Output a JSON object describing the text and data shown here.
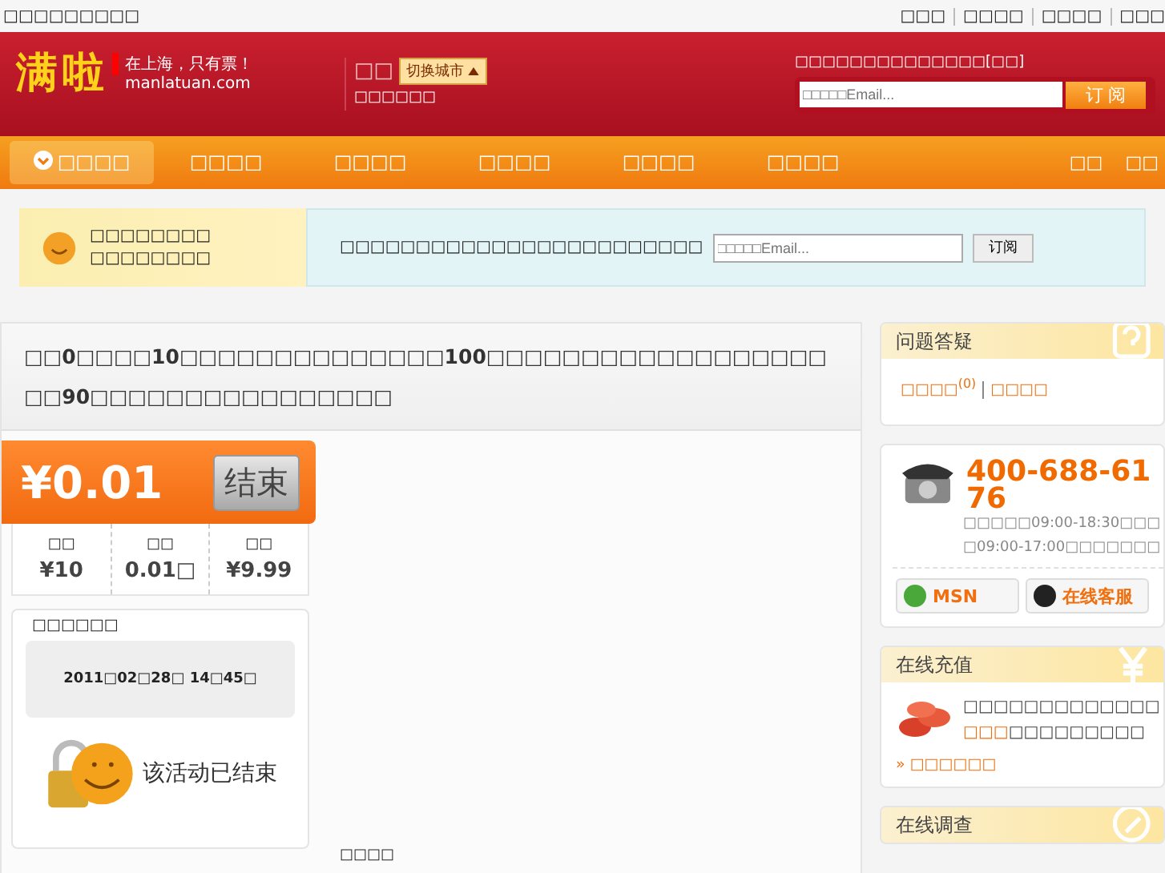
{
  "top_bar": {
    "tagline": "□□□□□□□□□",
    "links": [
      "□□□",
      "□□□□",
      "□□□□",
      "□□□"
    ]
  },
  "header": {
    "logo": "满啦",
    "logo_slogan": "在上海，只有票！",
    "logo_domain": "manlatuan.com",
    "city": "□□",
    "city_switch": "切换城市",
    "city_note": "□□□□□□",
    "subscribe_label": "□□□□□□□□□□□□□□[□□]",
    "email_placeholder": "□□□□□Email...",
    "subscribe_button": "订 阅"
  },
  "nav": {
    "items": [
      {
        "label": "□□□□",
        "selected": true
      },
      {
        "label": "□□□□",
        "selected": false
      },
      {
        "label": "□□□□",
        "selected": false
      },
      {
        "label": "□□□□",
        "selected": false
      },
      {
        "label": "□□□□",
        "selected": false
      },
      {
        "label": "□□□□",
        "selected": false
      }
    ],
    "right_links": [
      "□□",
      "□□"
    ]
  },
  "notice": {
    "lines": [
      "□□□□□□□□",
      "□□□□□□□□"
    ],
    "prompt": "□□□□□□□□□□□□□□□□□□□□□□□□",
    "email_placeholder": "□□□□□Email...",
    "button": "订阅"
  },
  "deal": {
    "title": "□□0□□□□10□□□□□□□□□□□□□□100□□□□□□□□□□□□□□□□□□□□90□□□□□□□□□□□□□□□□",
    "price": "¥0.01",
    "status_button": "结束",
    "stats": [
      {
        "label": "□□",
        "value": "¥10"
      },
      {
        "label": "□□",
        "value": "0.01□"
      },
      {
        "label": "□□",
        "value": "¥9.99"
      }
    ],
    "time_heading": "□□□□□□",
    "end_time": "2011□02□28□ 14□45□",
    "ended_text": "该活动已结束",
    "footer_text": "□□□□"
  },
  "sidebar": {
    "qa": {
      "title": "问题答疑",
      "link": "□□□□$^{(0)}$",
      "link2": "□□□□"
    },
    "contact": {
      "phone": "400-688-6176",
      "hours": "□□□□□09:00-18:30□□□□09:00-17:00□□□□□□□",
      "msn": "MSN",
      "online_service": "在线客服"
    },
    "recharge": {
      "title": "在线充值",
      "line1": "□□□□□□□□□□□□□",
      "line2_highlight": "□□□",
      "line2_rest": "□□□□□□□□□",
      "link": "» □□□□□□"
    },
    "survey": {
      "title": "在线调查"
    }
  }
}
